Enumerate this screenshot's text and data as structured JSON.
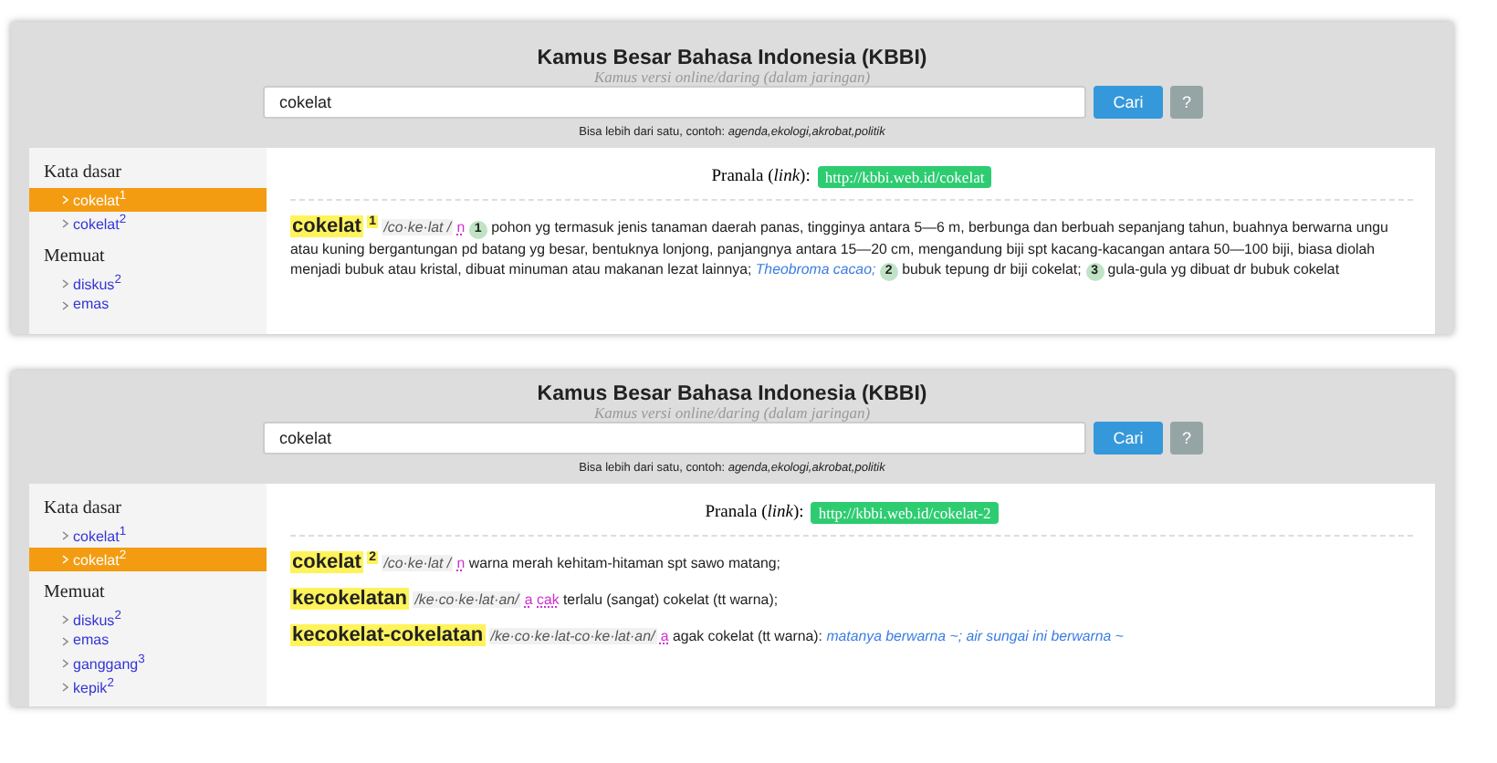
{
  "panels": [
    {
      "header": {
        "title": "Kamus Besar Bahasa Indonesia (KBBI)",
        "subtitle": "Kamus versi online/daring (dalam jaringan)",
        "search": {
          "value": "cokelat"
        },
        "buttons": [
          {
            "label": "Cari",
            "kind": "primary"
          },
          {
            "label": "?",
            "kind": "help"
          }
        ],
        "hint": "Bisa lebih dari satu, contoh: *agenda,ekologi,akrobat,politik*"
      },
      "sidebar": {
        "sections": [
          {
            "heading": "Kata dasar",
            "items": [
              {
                "label": "cokelat$^{1}$",
                "selected": true
              },
              {
                "label": "cokelat$^{2}$",
                "selected": false
              }
            ]
          },
          {
            "heading": "Memuat",
            "items": [
              {
                "label": "diskus$^{2}$",
                "selected": false
              },
              {
                "label": "emas",
                "selected": false
              }
            ]
          }
        ]
      },
      "content": {
        "permalink_label": "Pranala (*link*):",
        "permalink": "http://kbbi.web.id/cokelat",
        "entries": [
          {
            "segments": [
              {
                "kind": "headword",
                "text": "cokelat"
              },
              {
                "kind": "homonym",
                "text": "1"
              },
              {
                "kind": "pronunciation",
                "text": "/co·ke·lat /"
              },
              {
                "kind": "label",
                "text": "n"
              },
              {
                "kind": "sense",
                "text": "1"
              },
              {
                "kind": "text",
                "text": "pohon yg termasuk jenis tanaman daerah panas, tingginya antara 5—6 m, berbunga dan berbuah sepanjang tahun, buahnya berwarna ungu atau kuning bergantungan pd batang yg besar, bentuknya lonjong, panjangnya antara 15—20 cm, mengandung biji spt kacang-kacangan antara 50—100 biji, biasa diolah menjadi bubuk atau kristal, dibuat minuman atau makanan lezat lainnya;"
              },
              {
                "kind": "example",
                "text": "Theobroma cacao;"
              },
              {
                "kind": "sense",
                "text": "2"
              },
              {
                "kind": "text",
                "text": "bubuk tepung dr biji cokelat;"
              },
              {
                "kind": "sense",
                "text": "3"
              },
              {
                "kind": "text",
                "text": "gula-gula yg dibuat dr bubuk cokelat"
              }
            ]
          }
        ]
      }
    },
    {
      "header": {
        "title": "Kamus Besar Bahasa Indonesia (KBBI)",
        "subtitle": "Kamus versi online/daring (dalam jaringan)",
        "search": {
          "value": "cokelat"
        },
        "buttons": [
          {
            "label": "Cari",
            "kind": "primary"
          },
          {
            "label": "?",
            "kind": "help"
          }
        ],
        "hint": "Bisa lebih dari satu, contoh: *agenda,ekologi,akrobat,politik*"
      },
      "sidebar": {
        "sections": [
          {
            "heading": "Kata dasar",
            "items": [
              {
                "label": "cokelat$^{1}$",
                "selected": false
              },
              {
                "label": "cokelat$^{2}$",
                "selected": true
              }
            ]
          },
          {
            "heading": "Memuat",
            "items": [
              {
                "label": "diskus$^{2}$",
                "selected": false
              },
              {
                "label": "emas",
                "selected": false
              },
              {
                "label": "ganggang$^{3}$",
                "selected": false
              },
              {
                "label": "kepik$^{2}$",
                "selected": false
              }
            ]
          }
        ]
      },
      "content": {
        "permalink_label": "Pranala (*link*):",
        "permalink": "http://kbbi.web.id/cokelat-2",
        "entries": [
          {
            "segments": [
              {
                "kind": "headword",
                "text": "cokelat"
              },
              {
                "kind": "homonym",
                "text": "2"
              },
              {
                "kind": "pronunciation",
                "text": "/co·ke·lat /"
              },
              {
                "kind": "label",
                "text": "n"
              },
              {
                "kind": "text",
                "text": "warna merah kehitam-hitaman spt sawo matang;"
              }
            ]
          },
          {
            "segments": [
              {
                "kind": "headword",
                "text": "kecokelatan"
              },
              {
                "kind": "pronunciation",
                "text": "/ke·co·ke·lat·an/"
              },
              {
                "kind": "label",
                "text": "a"
              },
              {
                "kind": "label",
                "text": "cak"
              },
              {
                "kind": "text",
                "text": "terlalu (sangat) cokelat (tt warna);"
              }
            ]
          },
          {
            "segments": [
              {
                "kind": "headword",
                "text": "kecokelat-cokelatan"
              },
              {
                "kind": "pronunciation",
                "text": "/ke·co·ke·lat-co·ke·lat·an/"
              },
              {
                "kind": "label",
                "text": "a"
              },
              {
                "kind": "text",
                "text": "agak cokelat (tt warna):"
              },
              {
                "kind": "example",
                "text": "matanya berwarna ~; air sungai ini berwarna ~"
              }
            ]
          }
        ]
      }
    }
  ]
}
